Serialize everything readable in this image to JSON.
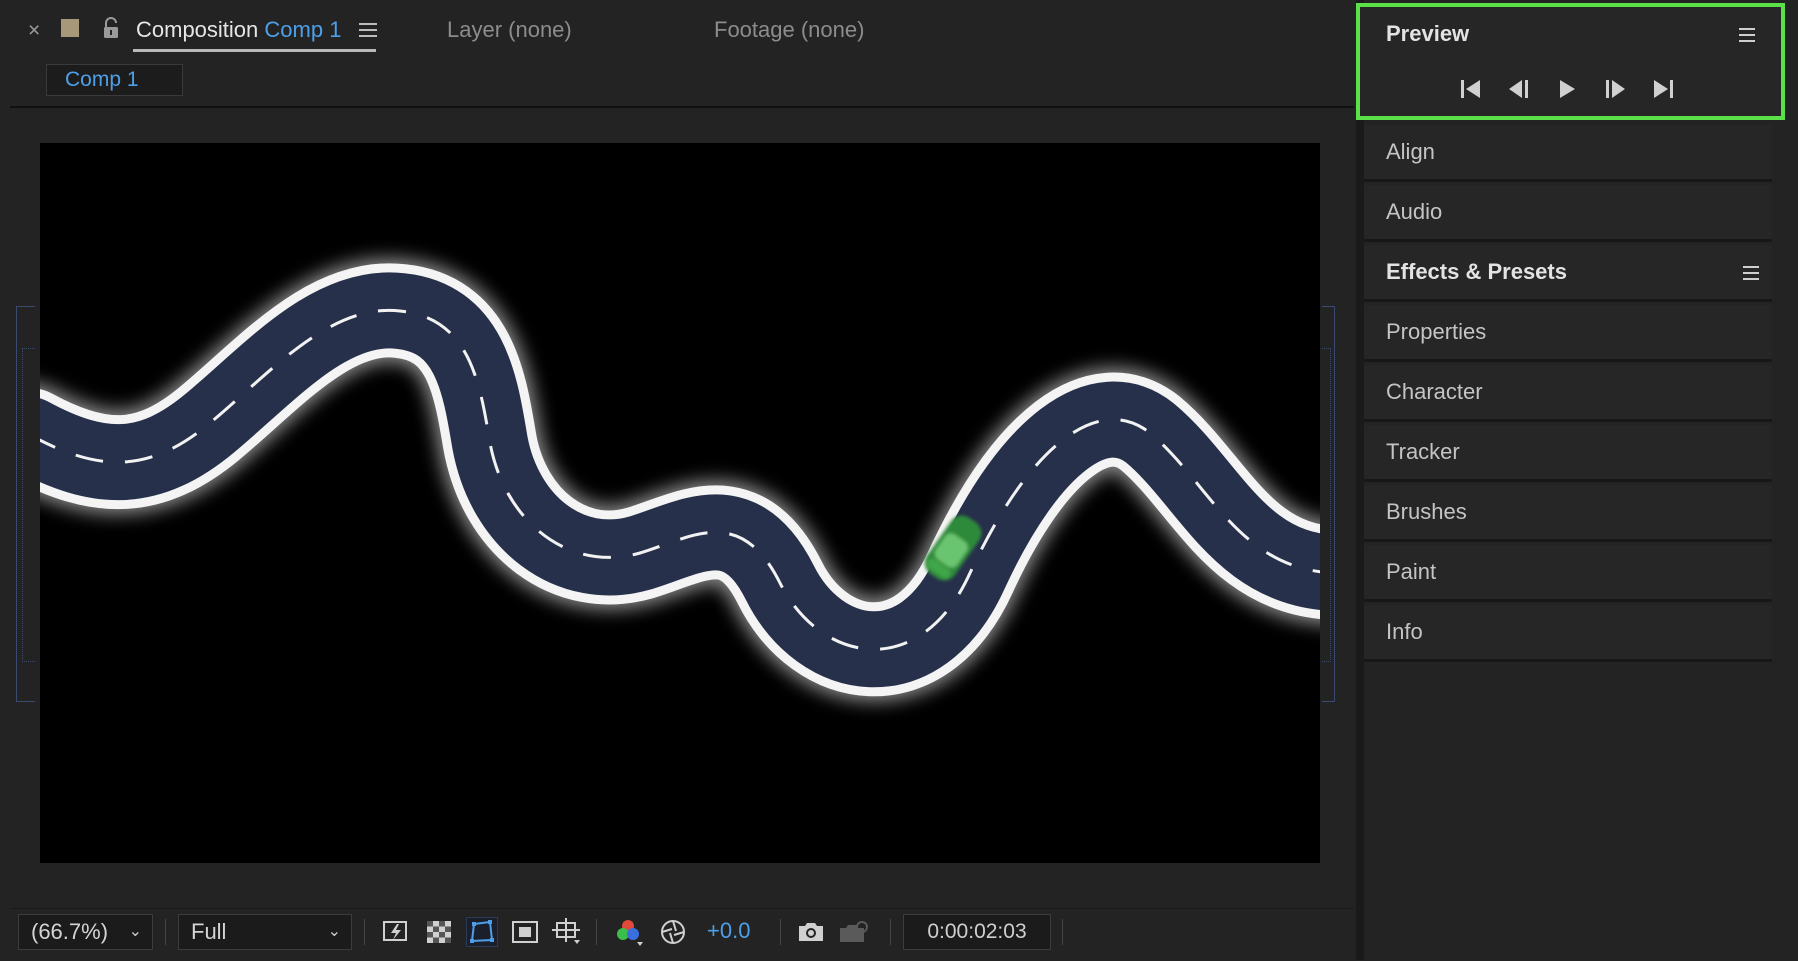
{
  "composition_tab": {
    "close_glyph": "×",
    "title_prefix": "Composition",
    "comp_name": "Comp 1",
    "swatch_color": "#a8987a",
    "accent_color": "#4e9fe8"
  },
  "other_tabs": {
    "layer": "Layer (none)",
    "footage": "Footage (none)"
  },
  "sub_tab": "Comp 1",
  "viewer_toolbar": {
    "zoom": "(66.7%)",
    "resolution": "Full",
    "exposure": "+0.0",
    "timecode": "0:00:02:03",
    "icons": [
      "fast-previews-icon",
      "transparency-grid-icon",
      "mask-visibility-icon",
      "region-of-interest-icon",
      "grid-guides-icon",
      "color-channels-icon",
      "exposure-reset-icon",
      "snapshot-icon",
      "show-snapshot-icon"
    ]
  },
  "preview_panel": {
    "title": "Preview",
    "highlight_color": "#5ce04a",
    "controls": [
      "first-frame-icon",
      "previous-frame-icon",
      "play-icon",
      "next-frame-icon",
      "last-frame-icon"
    ]
  },
  "side_panels": [
    {
      "label": "Align"
    },
    {
      "label": "Audio"
    },
    {
      "label": "Effects & Presets"
    },
    {
      "label": "Properties"
    },
    {
      "label": "Character"
    },
    {
      "label": "Tracker"
    },
    {
      "label": "Brushes"
    },
    {
      "label": "Paint"
    },
    {
      "label": "Info"
    }
  ]
}
